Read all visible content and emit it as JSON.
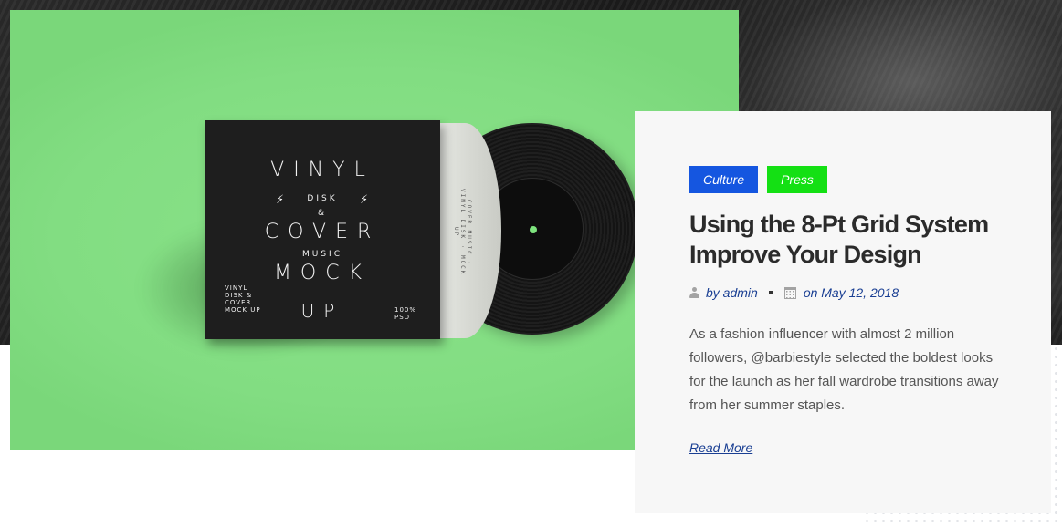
{
  "article": {
    "tags": [
      {
        "label": "Culture",
        "color": "#1556e0"
      },
      {
        "label": "Press",
        "color": "#14e014"
      }
    ],
    "title": "Using the 8-Pt Grid System Improve Your Design",
    "meta": {
      "author": "by admin",
      "author_icon": "user-icon",
      "date": "on May 12, 2018",
      "date_icon": "calendar-icon"
    },
    "excerpt": "As a fashion influencer with almost 2 million followers, @barbiestyle selected the boldest looks for the launch as her fall wardrobe transitions away from her summer staples.",
    "read_more": "Read More"
  },
  "feature_image": {
    "background_color": "#82dd82",
    "cover": {
      "line1": "VINYL",
      "line2": "DISK",
      "line3": "&",
      "line4": "COVER",
      "line5": "MUSIC",
      "line6": "MOCK",
      "line7": "UP",
      "corner_left": "VINYL DISK & COVER MOCK UP",
      "corner_right": "100% PSD"
    },
    "sleeve_text": "COVER MUSIC · VINYL DISK · MOCK UP"
  },
  "colors": {
    "accent_link": "#1a3f93",
    "card_bg": "#f7f7f7",
    "title": "#2b2b2b"
  }
}
